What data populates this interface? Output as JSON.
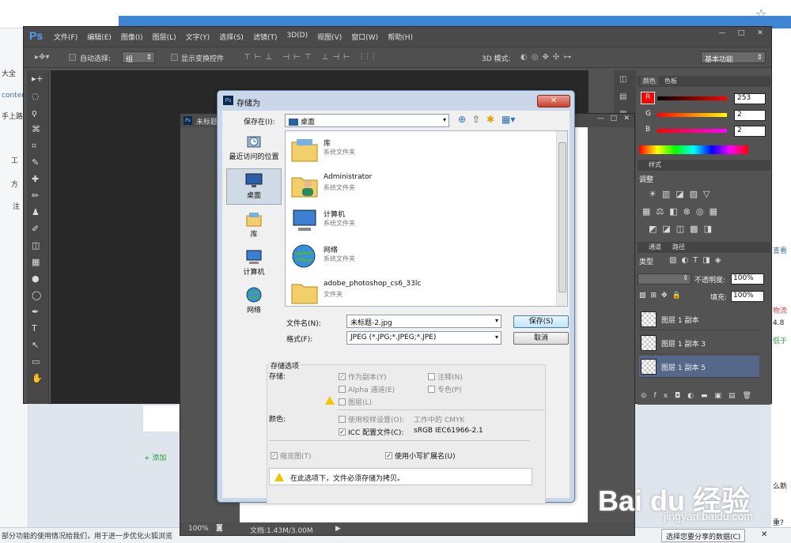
{
  "browser": {
    "left_items": [
      "大全",
      "conter",
      "手上路",
      "工",
      "方",
      "注"
    ],
    "right_items": [
      "查看",
      "物流",
      "4.8",
      "低于",
      "么新",
      "重?"
    ],
    "add_text": "+ 添加",
    "status_message": "部分功能的使用情况给我们，用于进一步优化火狐浏览",
    "share_button": "选择您要分享的数据(C)",
    "close_x": "✕"
  },
  "photoshop": {
    "logo": "Ps",
    "menu": [
      "文件(F)",
      "编辑(E)",
      "图像(I)",
      "图层(L)",
      "文字(Y)",
      "选择(S)",
      "滤镜(T)",
      "3D(D)",
      "视图(V)",
      "窗口(W)",
      "帮助(H)"
    ],
    "window_buttons": [
      "—",
      "□",
      "✕"
    ],
    "options": {
      "auto_select": "自动选择:",
      "group_value": "组",
      "show_transform": "显示变换控件",
      "mode_3d": "3D 模式:",
      "workspace": "基本功能"
    },
    "tools": [
      "▸+",
      "◌",
      "ϙ",
      "⌘",
      "⌗",
      "✎",
      "✚",
      "✏",
      "♟",
      "✐",
      "◫",
      "▦",
      "●",
      "◯",
      "✒",
      "T",
      "↖",
      "▭",
      "✋"
    ],
    "panels": {
      "color_tabs": [
        "颜色",
        "色板"
      ],
      "rgb": [
        {
          "label": "R",
          "value": "253"
        },
        {
          "label": "G",
          "value": "2"
        },
        {
          "label": "B",
          "value": "2"
        }
      ],
      "foreground_color": "#fd0202",
      "styles_tab": "样式",
      "adjust_title": "调整",
      "layers_tabs": [
        "通道",
        "路径"
      ],
      "kind_label": "类型",
      "opacity_label": "不透明度:",
      "opacity_value": "100%",
      "fill_label": "填充:",
      "fill_value": "100%",
      "layers": [
        {
          "name": "图层 1 副本",
          "selected": false
        },
        {
          "name": "图层 1 副本 3",
          "selected": false
        },
        {
          "name": "图层 1 副本 5",
          "selected": true
        }
      ]
    }
  },
  "document": {
    "title": "未标题",
    "zoom": "100%",
    "doc_info": "文档:1.43M/3.00M"
  },
  "save_dialog": {
    "title": "存储为",
    "save_in_label": "保存在(I):",
    "save_in_value": "桌面",
    "places": [
      {
        "label": "最近访问的位置",
        "selected": false
      },
      {
        "label": "桌面",
        "selected": true
      },
      {
        "label": "库",
        "selected": false
      },
      {
        "label": "计算机",
        "selected": false
      },
      {
        "label": "网络",
        "selected": false
      }
    ],
    "files": [
      {
        "name": "库",
        "type": "系统文件夹"
      },
      {
        "name": "Administrator",
        "type": "系统文件夹"
      },
      {
        "name": "计算机",
        "type": "系统文件夹"
      },
      {
        "name": "网络",
        "type": "系统文件夹"
      },
      {
        "name": "adobe_photoshop_cs6_33lc",
        "type": "文件夹"
      }
    ],
    "filename_label": "文件名(N):",
    "filename_value": "未标题-2.jpg",
    "format_label": "格式(F):",
    "format_value": "JPEG (*.JPG;*.JPEG;*.JPE)",
    "save_button": "保存(S)",
    "cancel_button": "取消",
    "options_title": "存储选项",
    "store_label": "存储:",
    "as_copy": "作为副本(Y)",
    "notes": "注释(N)",
    "alpha": "Alpha 通道(E)",
    "spot": "专色(P)",
    "layers": "图层(L)",
    "color_label": "颜色:",
    "proof": "使用校样设置(O):",
    "proof_value": "工作中的 CMYK",
    "icc": "ICC 配置文件(C):",
    "icc_value": "sRGB IEC61966-2.1",
    "thumbnail": "缩览图(T)",
    "lowercase": "使用小写扩展名(U)",
    "warning": "在此选项下，文件必须存储为拷贝。"
  },
  "watermark": {
    "brand": "Bai du 经验",
    "url": "jingyan.baidu.com"
  }
}
